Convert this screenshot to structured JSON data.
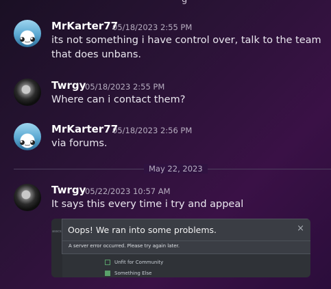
{
  "messages": [
    {
      "author": "MrKarter77",
      "timestamp": "05/18/2023 2:55 PM",
      "lines": [
        "its not something i have control over, talk to the team",
        "that does unbans."
      ]
    },
    {
      "author": "Twrgy",
      "timestamp": "05/18/2023 2:55 PM",
      "lines": [
        "Where can i contact them?"
      ]
    },
    {
      "author": "MrKarter77",
      "timestamp": "05/18/2023 2:56 PM",
      "lines": [
        "via forums."
      ]
    },
    {
      "author": "Twrgy",
      "timestamp": "05/22/2023 10:57 AM",
      "lines": [
        "It says this every time i try and appeal"
      ]
    }
  ],
  "date_divider": "May 22, 2023",
  "attachment": {
    "modal_title": "Oops! We ran into some problems.",
    "close_glyph": "×",
    "error_text": "A server error occurred. Please try again later.",
    "options": [
      "Unfit for Community",
      "Something Else"
    ],
    "side_label": "asscs"
  },
  "top_cut_text": "g"
}
